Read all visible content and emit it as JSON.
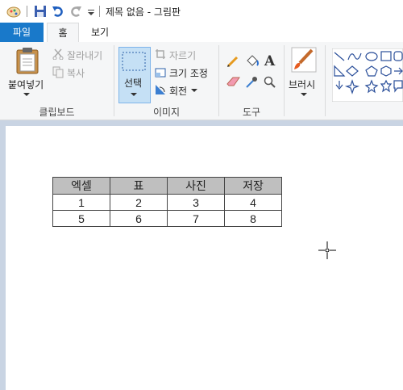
{
  "window": {
    "title": "제목 없음 - 그림판"
  },
  "tabs": [
    {
      "label": "파일"
    },
    {
      "label": "홈"
    },
    {
      "label": "보기"
    }
  ],
  "ribbon": {
    "clipboard": {
      "paste": "붙여넣기",
      "cut": "잘라내기",
      "copy": "복사",
      "group": "클립보드"
    },
    "image": {
      "select": "선택",
      "crop": "자르기",
      "resize": "크기 조정",
      "rotate": "회전",
      "group": "이미지"
    },
    "tools": {
      "group": "도구"
    },
    "brushes": {
      "label": "브러시"
    }
  },
  "table": {
    "headers": [
      "엑셀",
      "표",
      "사진",
      "저장"
    ],
    "rows": [
      [
        "1",
        "2",
        "3",
        "4"
      ],
      [
        "5",
        "6",
        "7",
        "8"
      ]
    ]
  }
}
